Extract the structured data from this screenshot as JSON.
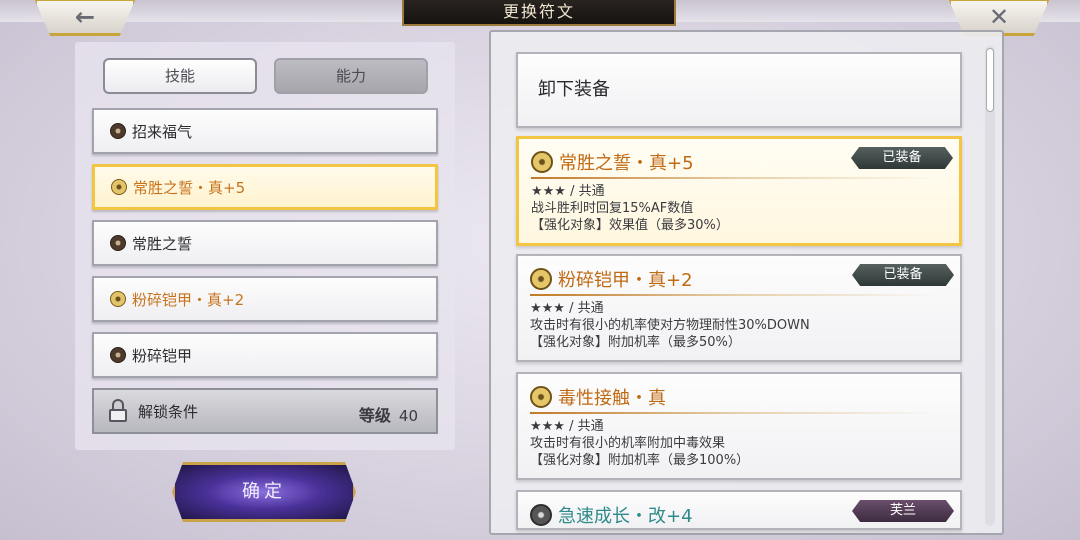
{
  "header": {
    "title": "更换符文",
    "back_icon": "←",
    "close_icon": "✕"
  },
  "tabs": [
    {
      "label": "技能"
    },
    {
      "label": "能力"
    }
  ],
  "slots": [
    {
      "label": "招来福气"
    },
    {
      "label": "常胜之誓・真+5"
    },
    {
      "label": "常胜之誓"
    },
    {
      "label": "粉碎铠甲・真+2"
    },
    {
      "label": "粉碎铠甲"
    }
  ],
  "lock_slot": {
    "label": "解锁条件",
    "level_label": "等级",
    "level_value": "40"
  },
  "confirm": {
    "label": "确定"
  },
  "unequip": {
    "label": "卸下装备"
  },
  "runes": [
    {
      "name": "常胜之誓・真+5",
      "badge": "已装备",
      "rarity": "★★★",
      "type": "/ 共通",
      "desc": "战斗胜利时回复15%AF数值",
      "target": "【强化对象】效果值（最多30%）"
    },
    {
      "name": "粉碎铠甲・真+2",
      "badge": "已装备",
      "rarity": "★★★",
      "type": "/ 共通",
      "desc": "攻击时有很小的机率使对方物理耐性30%DOWN",
      "target": "【强化对象】附加机率（最多50%）"
    },
    {
      "name": "毒性接触・真",
      "badge": "",
      "rarity": "★★★",
      "type": "/ 共通",
      "desc": "攻击时有很小的机率附加中毒效果",
      "target": "【强化对象】附加机率（最多100%）"
    },
    {
      "name": "急速成长・改+4",
      "badge": "芙兰"
    }
  ]
}
